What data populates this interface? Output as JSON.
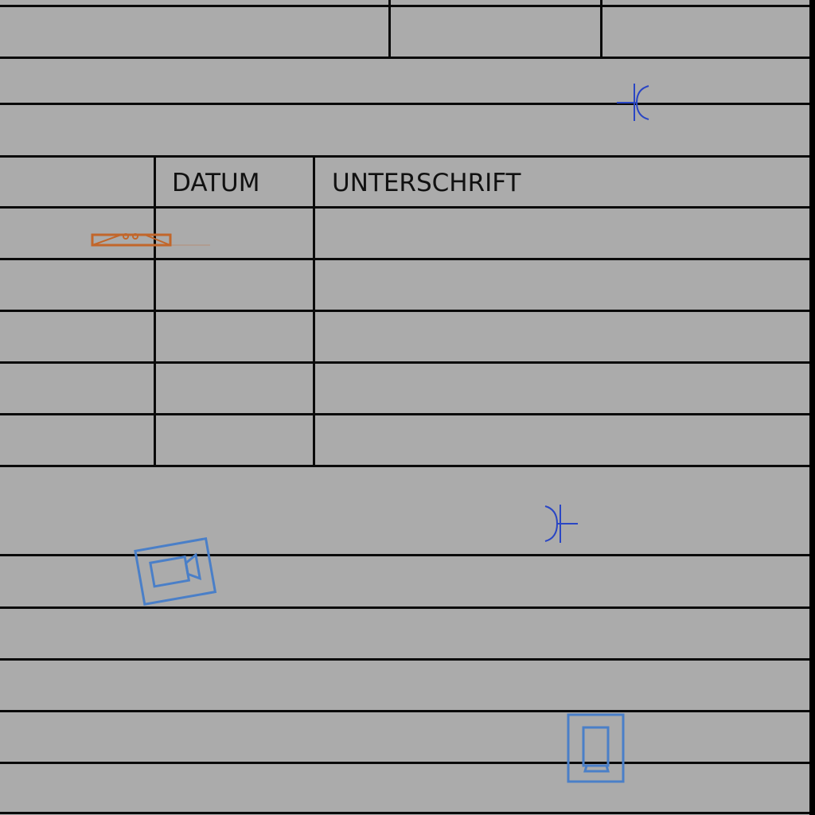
{
  "form_table": {
    "headers": {
      "datum": "DATUM",
      "unterschrift": "UNTERSCHRIFT"
    }
  },
  "symbols": {
    "capacitor_top": {
      "name": "capacitor-symbol-icon",
      "color": "#2a46c4"
    },
    "capacitor_middle": {
      "name": "capacitor-symbol-icon",
      "color": "#2a46c4"
    },
    "tray": {
      "name": "tray-icon",
      "color": "#c2662a"
    },
    "camera": {
      "name": "video-camera-icon",
      "color": "#4a7fc8"
    },
    "device": {
      "name": "device-icon",
      "color": "#4a7fc8"
    }
  }
}
